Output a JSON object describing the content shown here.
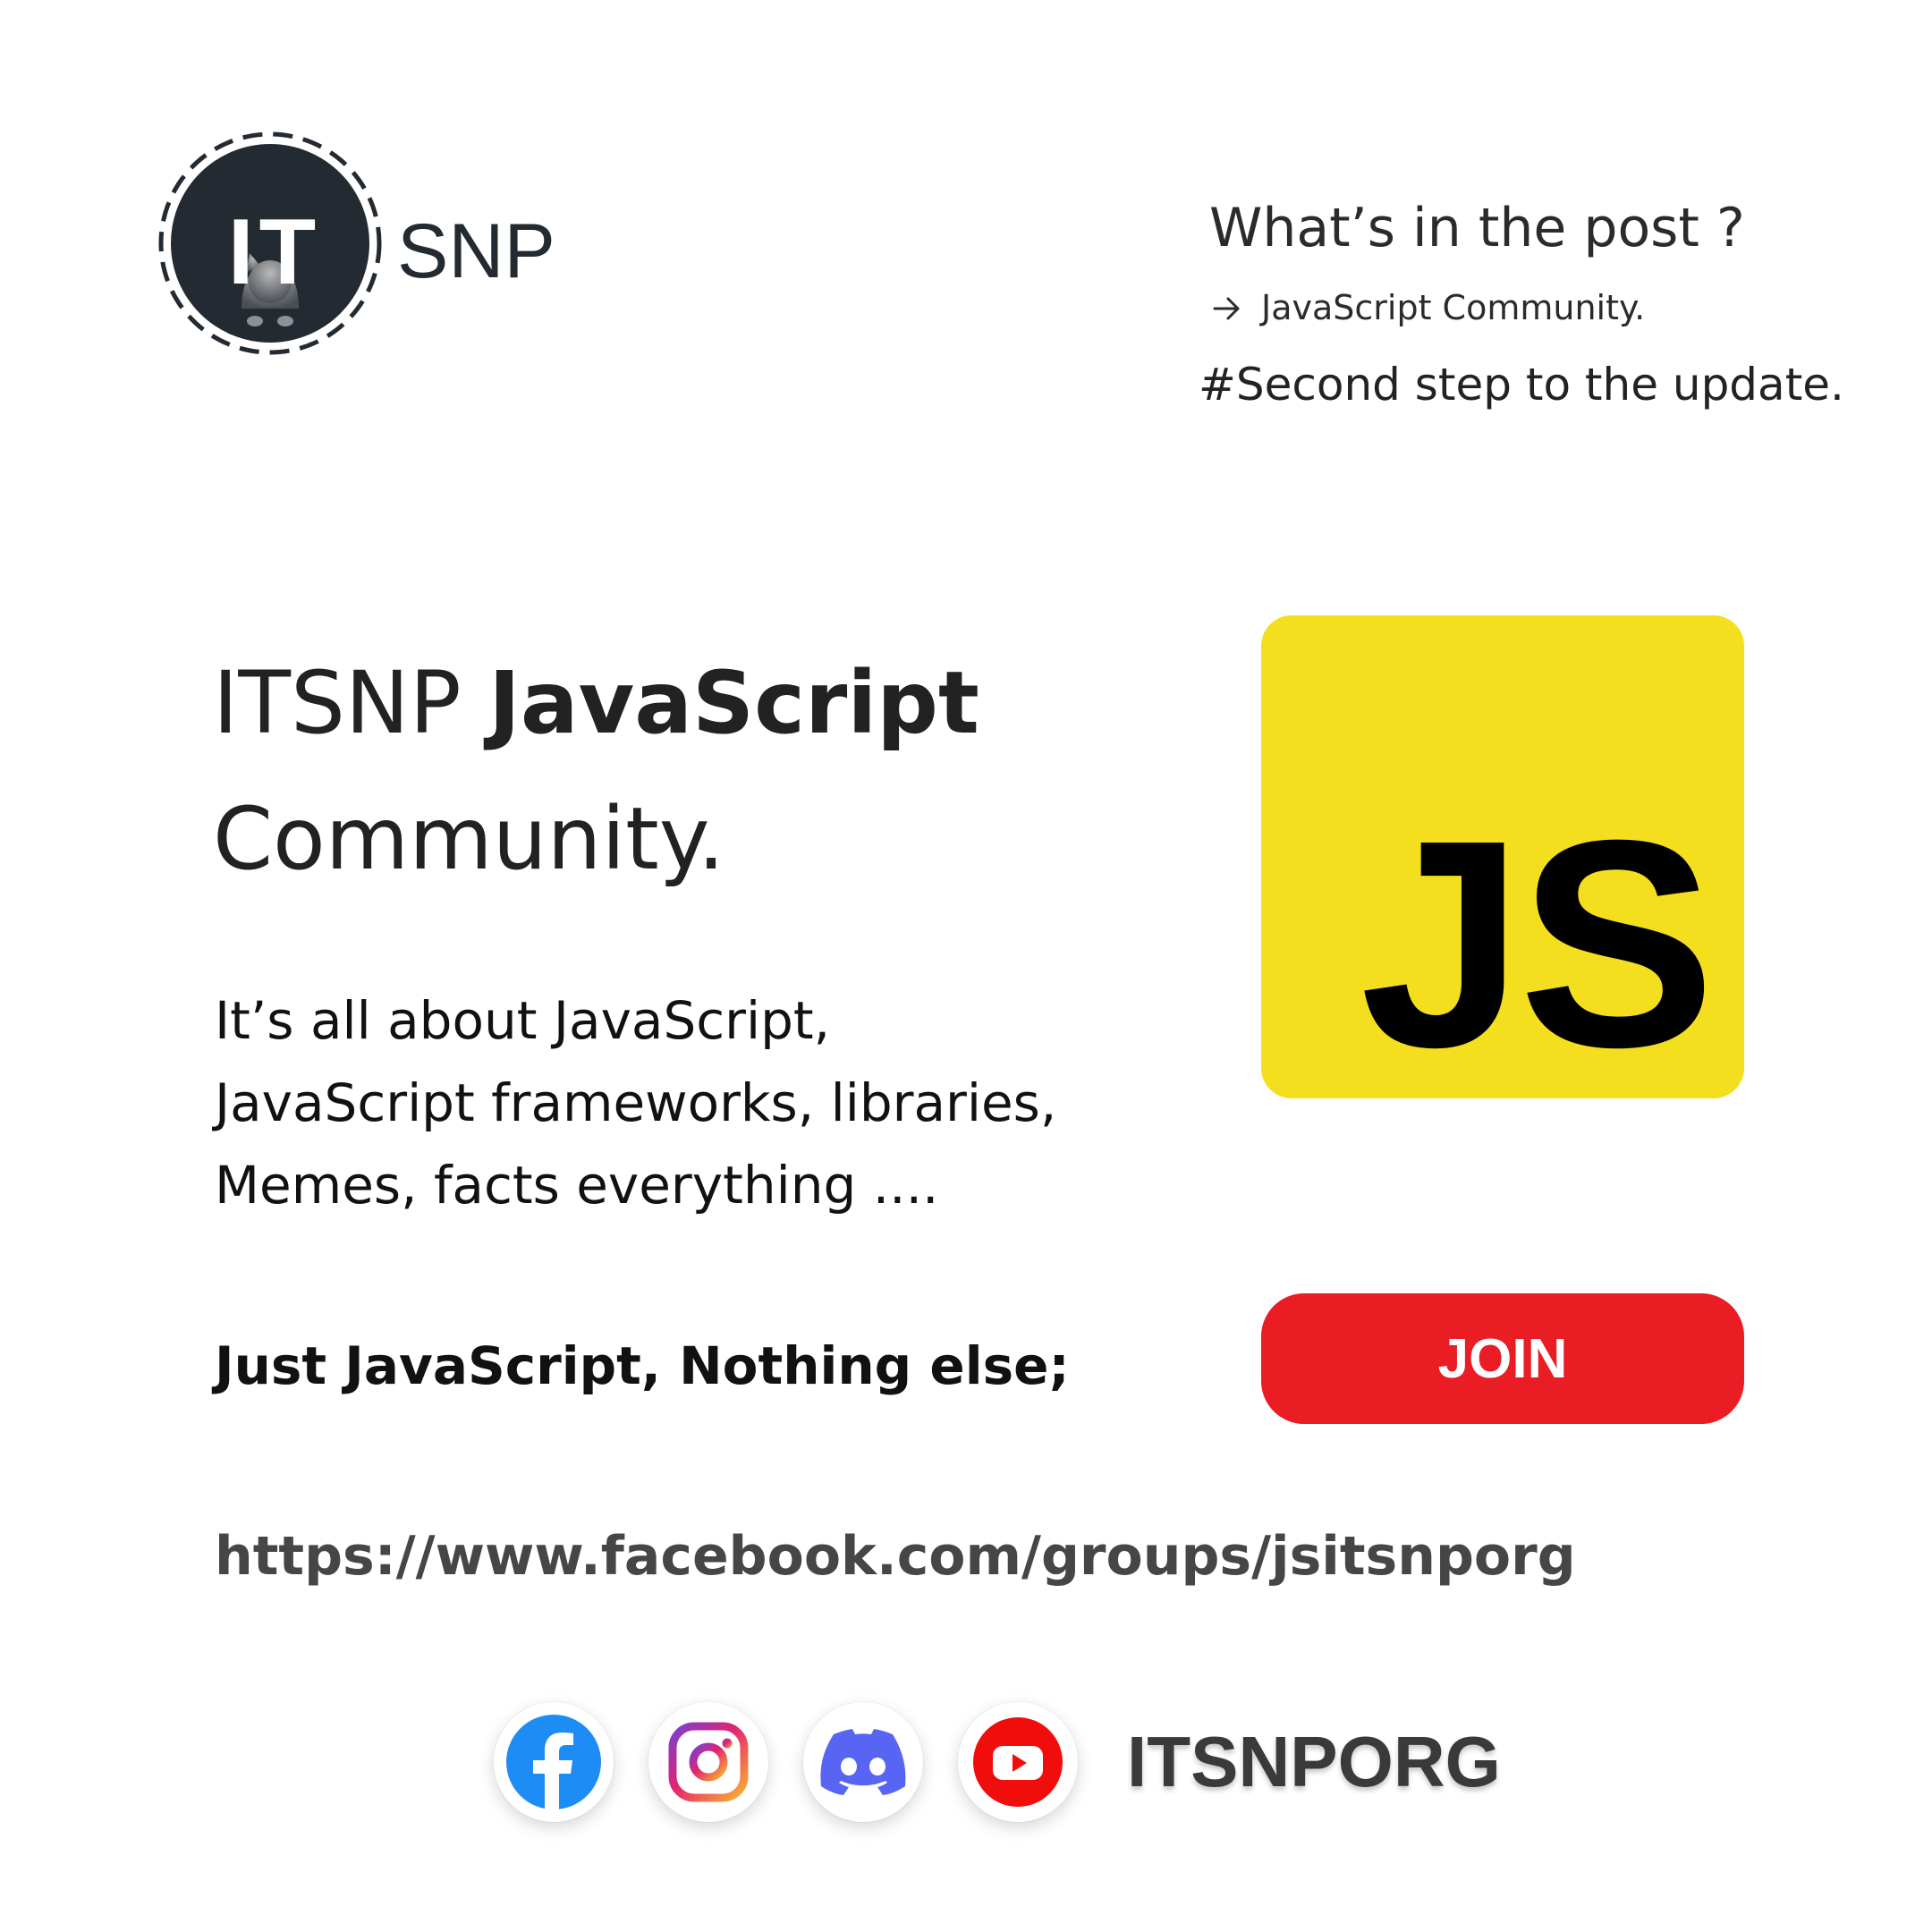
{
  "logo": {
    "letters": "IT",
    "suffix": "SNP"
  },
  "post_info": {
    "heading": "What’s in the post ?",
    "item": "JavaScript Community.",
    "tag": "#Second step to the update."
  },
  "headline": {
    "prefix": "ITSNP ",
    "bold": "JavaScript",
    "line2": "Community."
  },
  "description": {
    "lines": [
      "It’s all about JavaScript,",
      "JavaScript frameworks, libraries,",
      "Memes, facts everything ...."
    ]
  },
  "tagline": "Just JavaScript, Nothing else;",
  "url": "https://www.facebook.com/groups/jsitsnporg",
  "js_logo": {
    "text": "JS",
    "background": "#f4df1e"
  },
  "join_button": {
    "label": "JOIN",
    "color": "#ea1c24"
  },
  "social": {
    "icons": [
      "facebook-icon",
      "instagram-icon",
      "discord-icon",
      "youtube-icon"
    ],
    "brand": "ITSNPORG"
  }
}
